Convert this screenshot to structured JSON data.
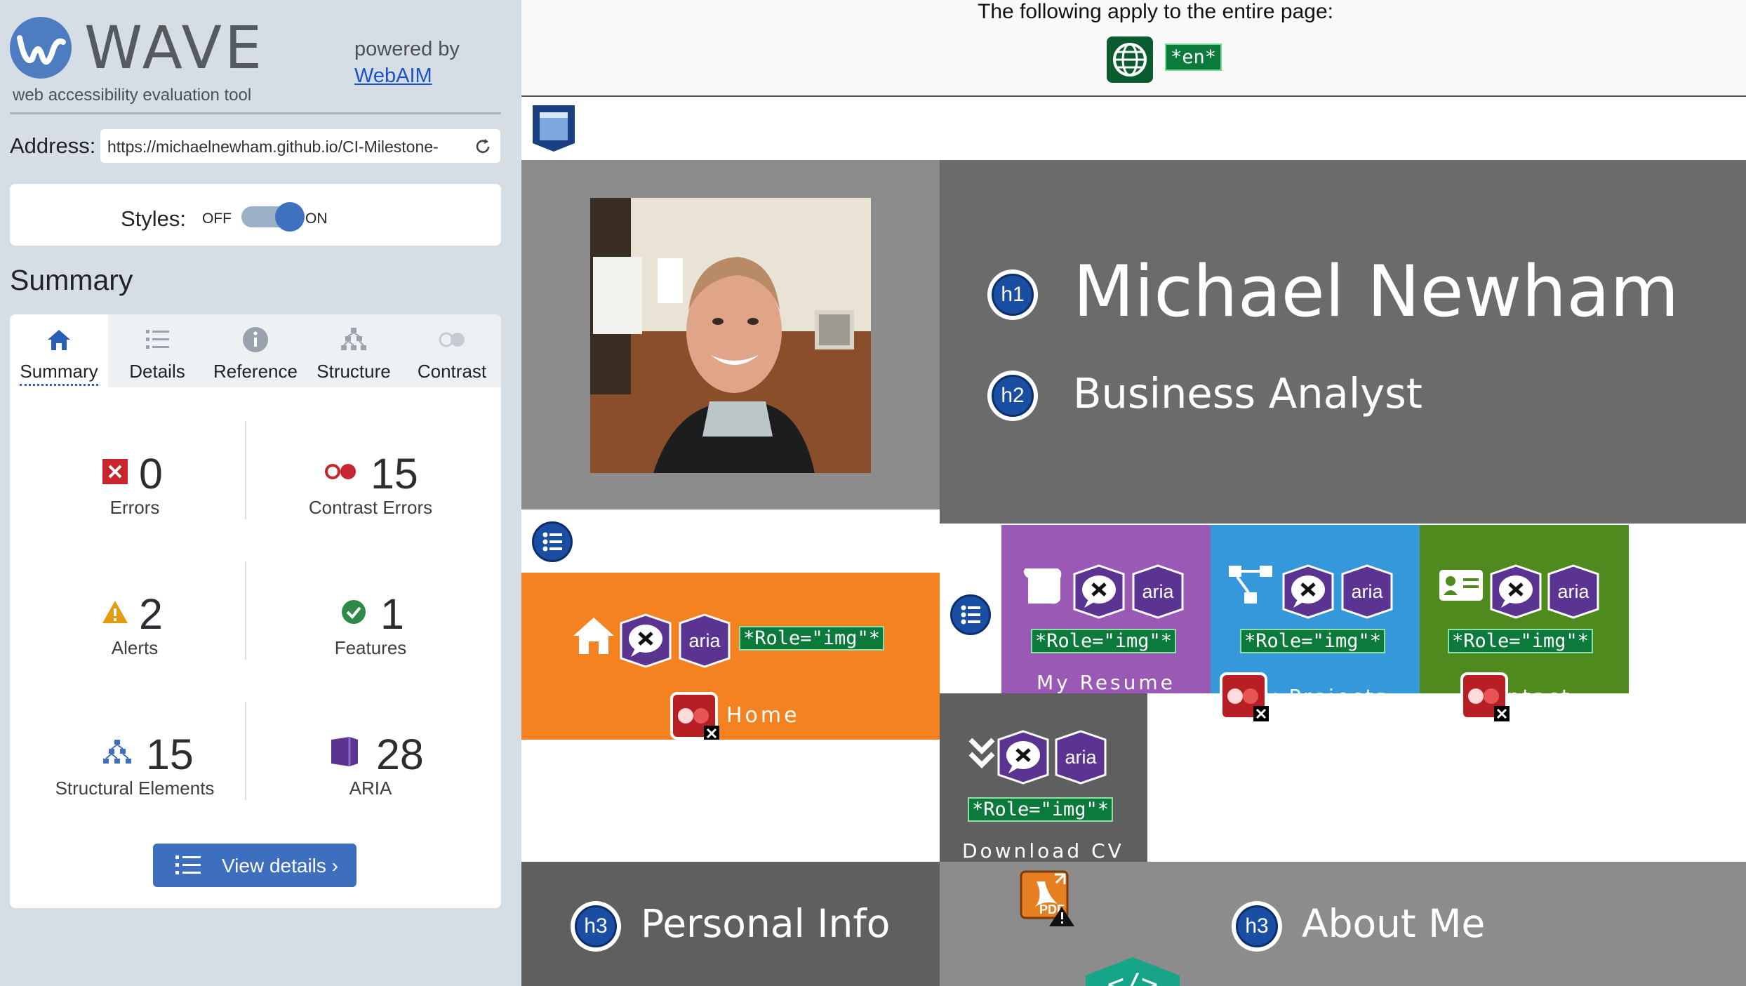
{
  "wave": {
    "title": "WAVE",
    "tagline": "web accessibility evaluation tool",
    "powered_by": "powered by",
    "webaim": "WebAIM",
    "address_label": "Address:",
    "address_value": "https://michaelnewham.github.io/CI-Milestone-",
    "styles_label": "Styles:",
    "styles_off": "OFF",
    "styles_on": "ON",
    "styles_state": "on",
    "summary_heading": "Summary",
    "tabs": [
      {
        "label": "Summary",
        "icon": "home-icon",
        "active": true
      },
      {
        "label": "Details",
        "icon": "list-icon",
        "active": false
      },
      {
        "label": "Reference",
        "icon": "info-icon",
        "active": false
      },
      {
        "label": "Structure",
        "icon": "structure-icon",
        "active": false
      },
      {
        "label": "Contrast",
        "icon": "contrast-icon",
        "active": false
      }
    ],
    "stats": {
      "errors": {
        "count": "0",
        "label": "Errors",
        "icon": "error-icon",
        "color": "#c8262e"
      },
      "contrast": {
        "count": "15",
        "label": "Contrast Errors",
        "icon": "contrast-error-icon",
        "color": "#c8262e"
      },
      "alerts": {
        "count": "2",
        "label": "Alerts",
        "icon": "alert-icon",
        "color": "#e39b0f"
      },
      "features": {
        "count": "1",
        "label": "Features",
        "icon": "feature-icon",
        "color": "#2f8a4a"
      },
      "structural": {
        "count": "15",
        "label": "Structural Elements",
        "icon": "structure-icon",
        "color": "#3e6fbf"
      },
      "aria": {
        "count": "28",
        "label": "ARIA",
        "icon": "aria-icon",
        "color": "#5b3391"
      }
    },
    "view_details": "View details ›"
  },
  "page": {
    "notice": "The following apply to the entire page:",
    "lang": "*en*",
    "name": "Michael Newham",
    "role": "Business Analyst",
    "h1": "h1",
    "h2": "h2",
    "h3": "h3",
    "aria": "aria",
    "role_img": "*Role=\"img\"*",
    "tiles": {
      "home": "Home",
      "resume": "My Resume",
      "projects": "My Projects",
      "contact": "Contact",
      "download": "Download CV"
    },
    "pdf": "PDF",
    "code_glyph": "</>",
    "personal_info": "Personal Info",
    "about_me": "About Me",
    "colors": {
      "orange": "#f58220",
      "purple": "#9b59b6",
      "blue": "#3498db",
      "green": "#4e8a1d",
      "dark_grey": "#5f5f5f",
      "mid_grey": "#8c8c8c"
    }
  }
}
